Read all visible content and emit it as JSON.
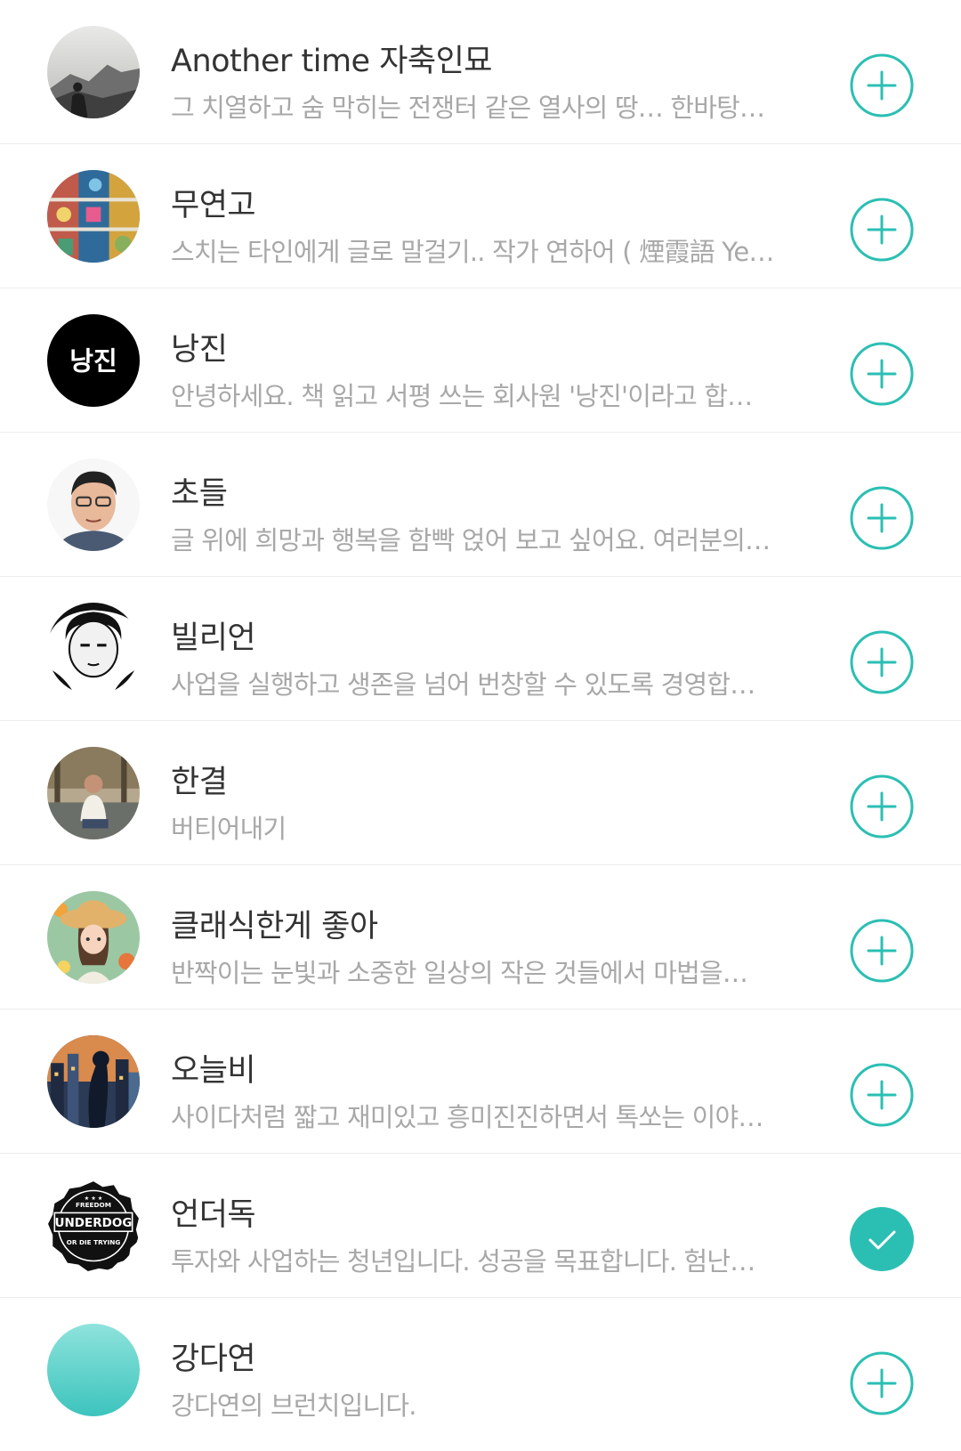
{
  "colors": {
    "accent": "#2bbfb3",
    "name_text": "#333333",
    "desc_text": "#a8a8a8",
    "divider": "#ededed"
  },
  "writers": [
    {
      "name": "Another time 자축인묘",
      "desc": "그 치열하고 숨 막히는 전쟁터 같은 열사의 땅… 한바탕…",
      "subscribed": false,
      "avatar": "mountain-photo"
    },
    {
      "name": "무연고",
      "desc": "스치는 타인에게 글로 말걸기.. 작가 연하어 ( 煙霞語 Ye…",
      "subscribed": false,
      "avatar": "toy-shelf-photo"
    },
    {
      "name": "낭진",
      "desc": "안녕하세요. 책 읽고 서평 쓰는 회사원 '낭진'이라고 합…",
      "subscribed": false,
      "avatar": "text-logo",
      "logo_text": "낭진"
    },
    {
      "name": "초들",
      "desc": "글 위에 희망과 행복을 함빡 얹어 보고 싶어요. 여러분의…",
      "subscribed": false,
      "avatar": "man-portrait-photo"
    },
    {
      "name": "빌리언",
      "desc": "사업을 실행하고 생존을 넘어 번창할 수 있도록 경영합…",
      "subscribed": false,
      "avatar": "bw-portrait-photo"
    },
    {
      "name": "한결",
      "desc": "버티어내기",
      "subscribed": false,
      "avatar": "seated-man-photo"
    },
    {
      "name": "클래식한게 좋아",
      "desc": "반짝이는 눈빛과 소중한 일상의 작은 것들에서 마법을…",
      "subscribed": false,
      "avatar": "girl-illustration"
    },
    {
      "name": "오늘비",
      "desc": "사이다처럼 짧고 재미있고 흥미진진하면서 톡쏘는 이야…",
      "subscribed": false,
      "avatar": "city-illustration"
    },
    {
      "name": "언더독",
      "desc": "투자와 사업하는 청년입니다. 성공을 목표합니다. 험난…",
      "subscribed": true,
      "avatar": "underdog-badge",
      "logo_text": {
        "top": "FREEDOM",
        "main": "UNDERDOG",
        "bottom": "OR DIE TRYING"
      }
    },
    {
      "name": "강다연",
      "desc": "강다연의 브런치입니다.",
      "subscribed": false,
      "avatar": "gradient-circle"
    }
  ]
}
